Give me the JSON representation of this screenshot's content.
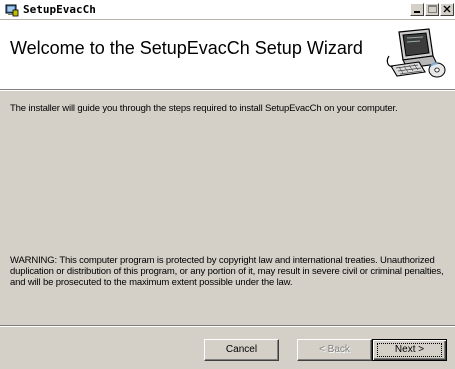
{
  "window": {
    "title": "SetupEvacCh",
    "controls": {
      "minimize": "minimize",
      "maximize": "maximize",
      "close": "close"
    }
  },
  "banner": {
    "heading": "Welcome to the SetupEvacCh Setup Wizard",
    "art_icon": "computer-disk-icon"
  },
  "body": {
    "intro": "The installer will guide you through the steps required to install SetupEvacCh on your computer.",
    "warning": "WARNING: This computer program is protected by copyright law and international treaties. Unauthorized duplication or distribution of this program, or any portion of it, may result in severe civil or criminal penalties, and will be prosecuted to the maximum extent possible under the law."
  },
  "buttons": {
    "cancel": "Cancel",
    "back": "< Back",
    "next": "Next >"
  },
  "colors": {
    "face": "#d4d0c8",
    "banner_bg": "#ffffff",
    "disabled_text": "#808080"
  }
}
